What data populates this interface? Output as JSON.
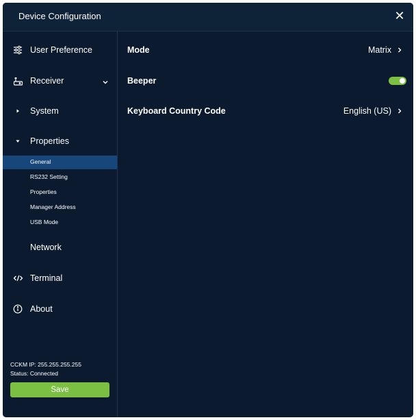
{
  "window": {
    "title": "Device Configuration"
  },
  "sidebar": {
    "items": [
      {
        "label": "User Preference",
        "icon": "sliders-icon"
      },
      {
        "label": "Receiver",
        "icon": "receiver-icon",
        "expanded": true
      },
      {
        "label": "System",
        "icon": "caret-right-icon"
      },
      {
        "label": "Properties",
        "icon": "caret-down-icon",
        "expanded": true
      },
      {
        "label": "Network"
      },
      {
        "label": "Terminal",
        "icon": "code-icon"
      },
      {
        "label": "About",
        "icon": "info-icon"
      }
    ],
    "subitems": [
      {
        "label": "General",
        "active": true
      },
      {
        "label": "RS232 Setting"
      },
      {
        "label": "Properties"
      },
      {
        "label": "Manager Address"
      },
      {
        "label": "USB Mode"
      }
    ],
    "status": {
      "ip": "CCKM IP: 255.255.255.255",
      "state": "Status: Connected"
    },
    "save_label": "Save"
  },
  "main": {
    "rows": [
      {
        "label": "Mode",
        "value": "Matrix"
      },
      {
        "label": "Beeper",
        "toggle": true
      },
      {
        "label": "Keyboard Country Code",
        "value": "English (US)"
      }
    ]
  },
  "colors": {
    "background": "#0b1a2f",
    "titlebar": "#0e2238",
    "active_item": "#16467a",
    "accent_green": "#7bc043",
    "text": "#ffffff"
  }
}
